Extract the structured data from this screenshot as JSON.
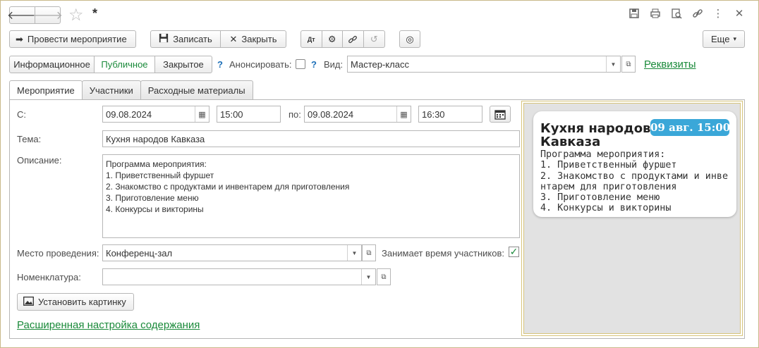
{
  "window": {
    "title": "*",
    "icons": [
      "back-arrow-icon",
      "forward-arrow-icon",
      "star-icon",
      "save-icon",
      "print-icon",
      "preview-icon",
      "link-icon",
      "more-icon",
      "close-icon"
    ]
  },
  "toolbar": {
    "post_label": "Провести мероприятие",
    "save_label": "Записать",
    "close_label": "Закрыть",
    "more_label": "Еще",
    "more_arrow": "▾"
  },
  "visibility": {
    "options": [
      "Информационное",
      "Публичное",
      "Закрытое"
    ],
    "selected": "Публичное",
    "announce_label": "Анонсировать:",
    "help_mark": "?",
    "type_label": "Вид:",
    "type_value": "Мастер-класс",
    "requisites_link": "Реквизиты"
  },
  "tabs": [
    "Мероприятие",
    "Участники",
    "Расходные материалы"
  ],
  "form": {
    "from_label": "С:",
    "from_date": "09.08.2024",
    "from_time": "15:00",
    "to_label": "по:",
    "to_date": "09.08.2024",
    "to_time": "16:30",
    "topic_label": "Тема:",
    "topic_value": "Кухня народов Кавказа",
    "description_label": "Описание:",
    "description_lines": [
      "Программа мероприятия:",
      "1. Приветственный фуршет",
      "2. Знакомство с продуктами и инвентарем для приготовления",
      "3. Приготовление меню",
      "4. Конкурсы и викторины"
    ],
    "place_label": "Место проведения:",
    "place_value": "Конференц-зал",
    "busy_label": "Занимает время участников:",
    "busy_checked": true,
    "nomenclature_label": "Номенклатура:",
    "nomenclature_value": "",
    "set_picture_label": "Установить картинку",
    "advanced_link": "Расширенная настройка содержания"
  },
  "preview": {
    "title_line1": "Кухня народов",
    "title_line2": "Кавказа",
    "badge": "09 авг. 15:00",
    "lines": [
      "Программа мероприятия:",
      "1. Приветственный фуршет",
      "2. Знакомство с продуктами и инве",
      "нтарем для приготовления",
      "3. Приготовление меню",
      "4. Конкурсы и викторины"
    ],
    "badge_color": "#3aa7d8"
  }
}
